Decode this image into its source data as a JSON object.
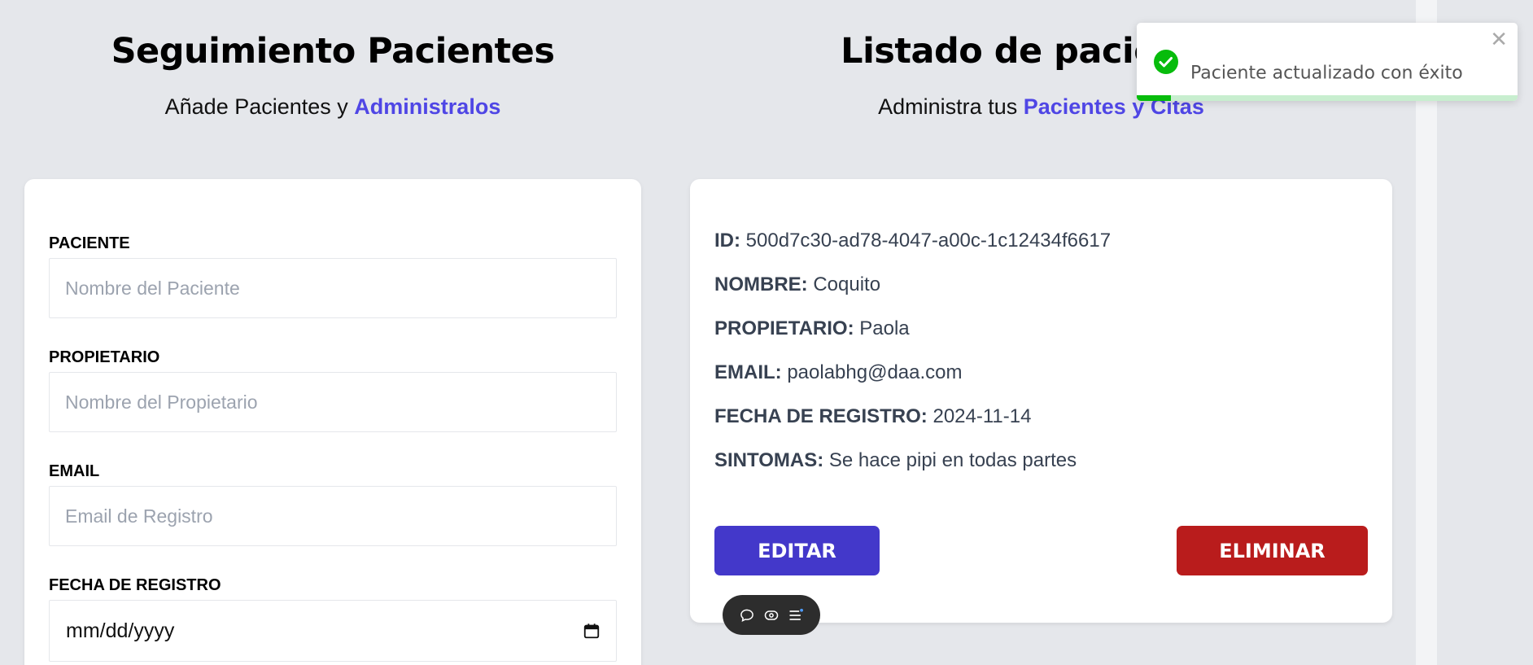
{
  "colors": {
    "accent": "#4f46e5",
    "edit_button": "#4338ca",
    "delete_button": "#b91c1c",
    "success": "#07bc0c"
  },
  "form": {
    "title": "Seguimiento Pacientes",
    "subtitle_prefix": "Añade Pacientes y ",
    "subtitle_accent": "Administralos",
    "fields": [
      {
        "label": "PACIENTE",
        "placeholder": "Nombre del Paciente",
        "value": ""
      },
      {
        "label": "PROPIETARIO",
        "placeholder": "Nombre del Propietario",
        "value": ""
      },
      {
        "label": "EMAIL",
        "placeholder": "Email de Registro",
        "value": ""
      }
    ],
    "date_field": {
      "label": "FECHA DE REGISTRO",
      "placeholder": "mm/dd/yyyy",
      "icon": "calendar-icon"
    }
  },
  "list": {
    "title": "Listado de pacientes",
    "subtitle_prefix": "Administra tus ",
    "subtitle_accent": "Pacientes y Citas",
    "patient": {
      "id_label": "ID:",
      "id_value": "500d7c30-ad78-4047-a00c-1c12434f6617",
      "name_label": "NOMBRE:",
      "name_value": "Coquito",
      "owner_label": "PROPIETARIO:",
      "owner_value": "Paola",
      "email_label": "EMAIL:",
      "email_value": "paolabhg@daa.com",
      "date_label": "FECHA DE REGISTRO:",
      "date_value": "2024-11-14",
      "symptoms_label": "SINTOMAS:",
      "symptoms_value": "Se hace pipi en todas partes"
    },
    "edit_label": "EDITAR",
    "delete_label": "ELIMINAR"
  },
  "toast": {
    "message": "Paciente actualizado con éxito",
    "icon": "check-circle-icon",
    "close_icon": "close-icon",
    "progress": 0.09
  },
  "floating_toolbar": {
    "icons": [
      "comment-icon",
      "eye-icon",
      "menu-icon"
    ]
  }
}
